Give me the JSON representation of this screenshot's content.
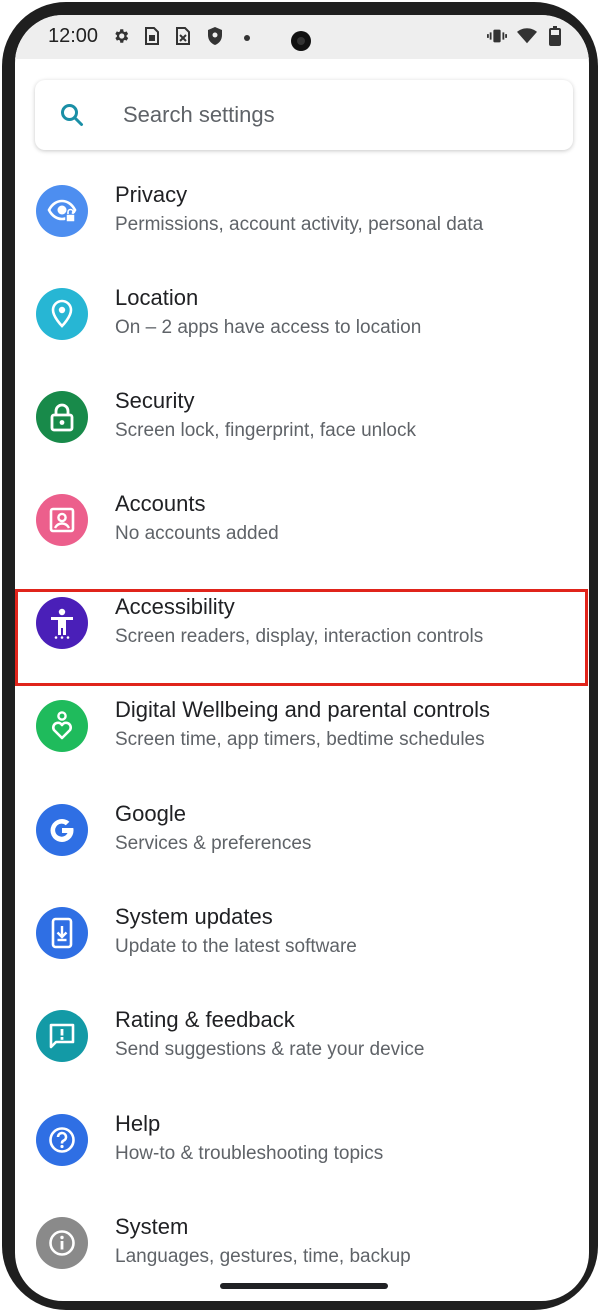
{
  "status_bar": {
    "time": "12:00",
    "left_icons": [
      "gear-icon",
      "sim-card-icon",
      "sim-card-blocked-icon",
      "shield-icon"
    ],
    "right_icons": [
      "vibrate-icon",
      "wifi-icon",
      "battery-icon"
    ]
  },
  "search": {
    "placeholder": "Search settings"
  },
  "settings": [
    {
      "title": "Privacy",
      "subtitle": "Permissions, account activity, personal data",
      "icon": "privacy-eye-icon",
      "color": "#4d8ef0"
    },
    {
      "title": "Location",
      "subtitle": "On – 2 apps have access to location",
      "icon": "location-pin-icon",
      "color": "#27b6d4"
    },
    {
      "title": "Security",
      "subtitle": "Screen lock, fingerprint, face unlock",
      "icon": "lock-icon",
      "color": "#188a4a"
    },
    {
      "title": "Accounts",
      "subtitle": "No accounts added",
      "icon": "account-box-icon",
      "color": "#ec5f8c"
    },
    {
      "title": "Accessibility",
      "subtitle": "Screen readers, display, interaction controls",
      "icon": "accessibility-person-icon",
      "color": "#4a1fb8"
    },
    {
      "title": "Digital Wellbeing and parental controls",
      "subtitle": "Screen time, app timers, bedtime schedules",
      "icon": "wellbeing-heart-icon",
      "color": "#1fbb5c"
    },
    {
      "title": "Google",
      "subtitle": "Services & preferences",
      "icon": "google-g-icon",
      "color": "#2f6fe4"
    },
    {
      "title": "System updates",
      "subtitle": "Update to the latest software",
      "icon": "system-update-icon",
      "color": "#2f6fe4"
    },
    {
      "title": "Rating & feedback",
      "subtitle": "Send suggestions & rate your device",
      "icon": "feedback-icon",
      "color": "#139aa6"
    },
    {
      "title": "Help",
      "subtitle": "How-to & troubleshooting topics",
      "icon": "help-icon",
      "color": "#2f6fe4"
    },
    {
      "title": "System",
      "subtitle": "Languages, gestures, time, backup",
      "icon": "info-icon",
      "color": "#8a8a8a"
    }
  ],
  "colors": {
    "highlight": "#e0241b",
    "search_accent": "#1a8fa6"
  }
}
